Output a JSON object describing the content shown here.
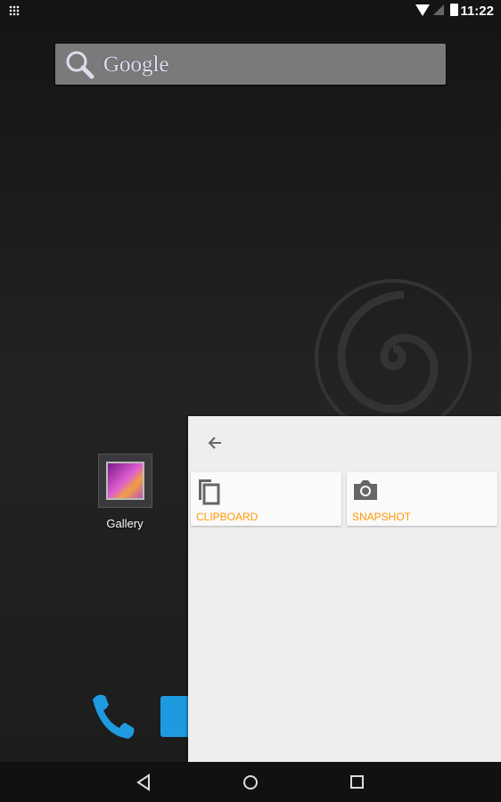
{
  "status_bar": {
    "time": "11:22",
    "icons": [
      "apps-grid-icon",
      "wifi-icon",
      "signal-icon",
      "battery-charging-icon"
    ]
  },
  "search_widget": {
    "label": "Google",
    "icon": "search-icon"
  },
  "home": {
    "apps": [
      {
        "label": "Gallery",
        "icon": "gallery-icon"
      }
    ],
    "dock": [
      "phone-icon",
      "contacts-icon"
    ]
  },
  "panel": {
    "back_icon": "arrow-back-icon",
    "accent": "#ff9800",
    "items": [
      {
        "label": "CLIPBOARD",
        "icon": "clipboard-copy-icon"
      },
      {
        "label": "SNAPSHOT",
        "icon": "camera-icon"
      }
    ]
  },
  "nav_bar": {
    "buttons": [
      "back-icon",
      "home-icon",
      "recents-icon"
    ]
  }
}
